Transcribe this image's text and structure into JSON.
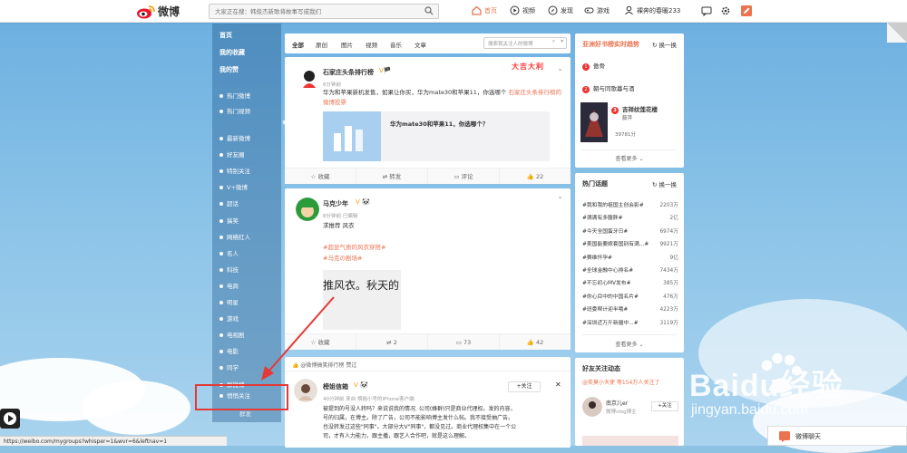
{
  "topbar": {
    "logo_text": "微博",
    "search_placeholder": "大家正在搜：韩俊杰新歌将故事写成我们",
    "nav": [
      {
        "label": "首页",
        "icon": "home-icon",
        "active": true
      },
      {
        "label": "视频",
        "icon": "video-icon",
        "active": false
      },
      {
        "label": "发现",
        "icon": "discover-icon",
        "active": false
      },
      {
        "label": "游戏",
        "icon": "game-icon",
        "active": false
      },
      {
        "label": "裸奔的春暖233",
        "icon": "user-icon",
        "active": false
      }
    ],
    "accent": "#eb7350"
  },
  "leftnav": {
    "top": [
      "首页",
      "我的收藏",
      "我的赞"
    ],
    "section1": [
      "热门微博",
      "热门视频"
    ],
    "section2": [
      "最新微博",
      "好友圈",
      "特别关注",
      "V+微博",
      "超话",
      "搞笑",
      "网络红人",
      "名人",
      "科技",
      "电商",
      "明星",
      "游戏",
      "电视剧",
      "电影",
      "同学",
      "群微博",
      "悄悄关注"
    ],
    "bottom": "群发"
  },
  "feed": {
    "tabs": [
      "全部",
      "原创",
      "图片",
      "视频",
      "音乐",
      "文章"
    ],
    "search_placeholder": "搜索我关注人的微博",
    "post1": {
      "user": "石家庄头条排行榜",
      "time": "6分钟前",
      "text": "华为和苹果新机发售，如果让你买，华为mate30和苹果11，你选哪个",
      "link_text": "石家庄头条排行榜的微博投票",
      "badge": "大吉大利",
      "vote_title": "华为mate30和苹果11，你选哪个？",
      "actions": [
        "收藏",
        "转发",
        "评论",
        "22"
      ]
    },
    "post2": {
      "user": "马克少年",
      "time": "8分钟前",
      "edited": "已编辑",
      "line1": "求推荐 风衣",
      "tag1": "#超显气质的风衣穿搭#",
      "tag2": "#马克の剧场#",
      "img_text": "推风衣。秋天的",
      "actions": [
        "收藏",
        "2",
        "73",
        "42"
      ]
    },
    "liked_bar": "@微博搞笑排行榜 赞过",
    "post3": {
      "user": "榜姐信箱",
      "time": "40分钟前",
      "source": "来自 榜姐小号的iPhone客户端",
      "follow": "+关注",
      "text1": "被提到的号没人转吗？来说说我的情况. 公司(蜂群)只是商业代理权。发的内容，",
      "text2": "号的归属，在博主。除了广告，公司不能影响博主发什么帖。我不接受抽广告。",
      "text3": "也没转发过这些\"同事\"。大部分大V\"同事\"，都没见过。商业代理权集中在一个公",
      "text4": "司，才有人力能力，跟主播，跟艺人合作吧，就是这么理解。"
    }
  },
  "right": {
    "panel1": {
      "title": "亚洲好书榜实时趋势",
      "swap": "换一换",
      "items": [
        "傲骨",
        "朝与同歌暮与酒",
        "吉祥纹莲花楼"
      ],
      "book_author": "藤萍",
      "book_count": "39781分",
      "more": "查看更多"
    },
    "panel2": {
      "title": "热门话题",
      "swap": "换一换",
      "topics": [
        {
          "name": "#我和我的祖国主创会影#",
          "count": "2203万"
        },
        {
          "name": "#满满有多腹胖#",
          "count": "2亿"
        },
        {
          "name": "#今天全国蛋牙日#",
          "count": "6974万"
        },
        {
          "name": "#美国能要嫁套国别有满...#",
          "count": "9921万"
        },
        {
          "name": "#赛维怀孕#",
          "count": "9亿"
        },
        {
          "name": "#全球金融中心排名#",
          "count": "7434万"
        },
        {
          "name": "#不忘初心MV发布#",
          "count": "385万"
        },
        {
          "name": "#你心目中的中国名片#",
          "count": "476万"
        },
        {
          "name": "#班委帮计迎半哦#",
          "count": "4223万"
        },
        {
          "name": "#深圳近万斤新疆中...#",
          "count": "3119万"
        }
      ],
      "more": "查看更多"
    },
    "panel3": {
      "title": "好友关注动态",
      "mention": "@奕莫小天使 等154万人关注了",
      "user": "南京儿er",
      "desc": "微博vlog博主",
      "follow": "+关注"
    }
  },
  "status_url": "https://weibo.com/mygroups?whisper=1&wvr=6&leftnav=1",
  "chat_label": "微博聊天",
  "watermark": {
    "brand": "Baidu经验",
    "url": "jingyan.baidu.com"
  }
}
